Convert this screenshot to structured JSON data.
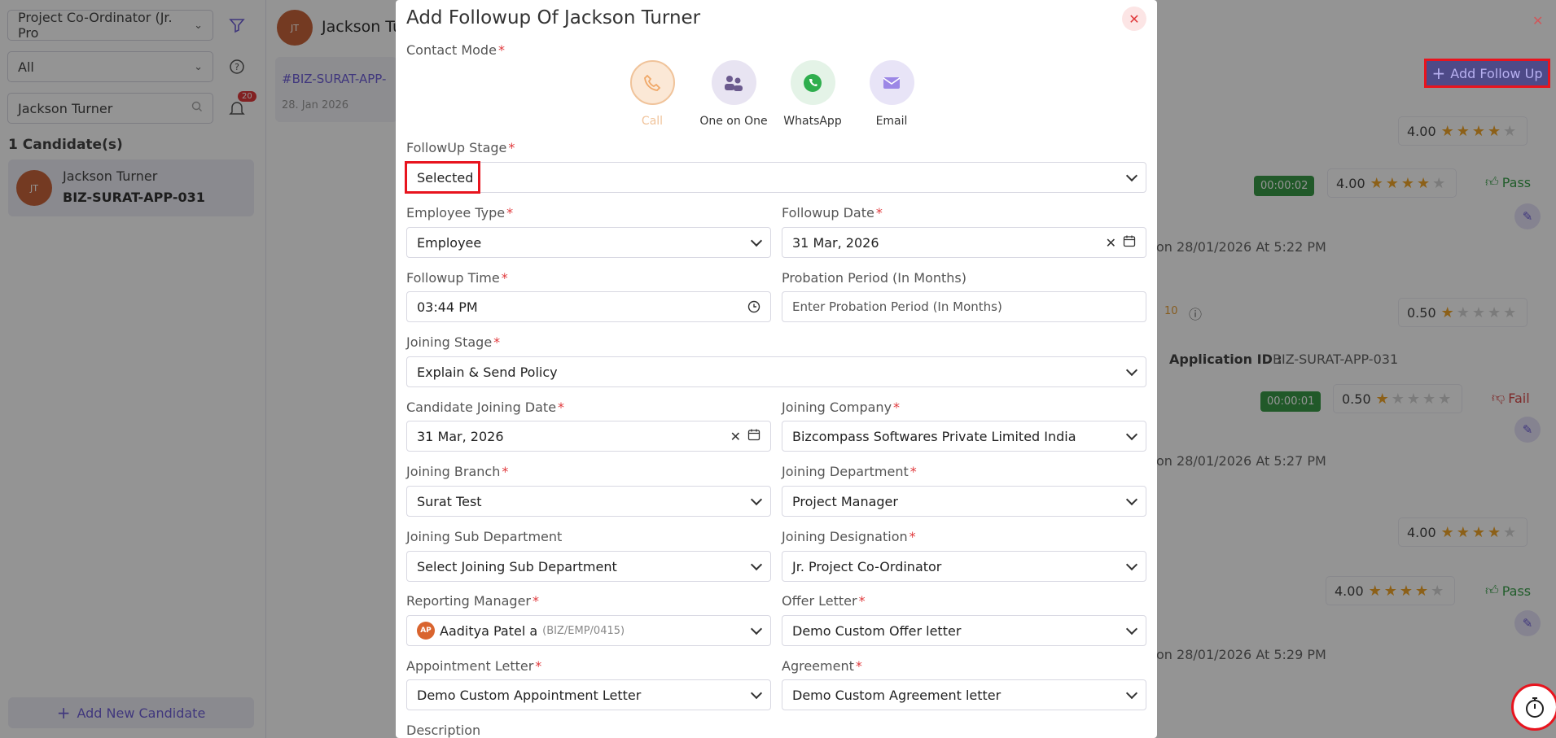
{
  "left_panel": {
    "role_filter": "Project Co-Ordinator (Jr. Pro",
    "status_filter": "All",
    "search_value": "Jackson Turner",
    "notification_count": "20",
    "candidate_count": "1 Candidate(s)",
    "candidate": {
      "initials": "JT",
      "name": "Jackson Turner",
      "app_id": "BIZ-SURAT-APP-031"
    },
    "add_candidate": "Add New Candidate"
  },
  "main": {
    "header_initials": "JT",
    "header_name": "Jackson Tu",
    "tab_id": "#BIZ-SURAT-APP-",
    "tab_date": "28. Jan 2026",
    "add_follow_up": "Add Follow Up",
    "ratings": [
      "4.00",
      "4.00",
      "0.50",
      "0.50",
      "4.00",
      "4.00"
    ],
    "timers": [
      "00:00:02",
      "00:00:01"
    ],
    "pass_label": "Pass",
    "fail_label": "Fail",
    "partial_number": "10",
    "logs": [
      "on 28/01/2026 At 5:22 PM",
      "on 28/01/2026 At 5:27 PM",
      "on 28/01/2026 At 5:29 PM"
    ],
    "application_id_label": "Application ID :",
    "application_id_value": "BIZ-SURAT-APP-031"
  },
  "modal": {
    "title": "Add Followup Of Jackson Turner",
    "contact_mode_label": "Contact Mode",
    "contact_modes": [
      {
        "label": "Call",
        "icon": "phone-icon",
        "active": true
      },
      {
        "label": "One on One",
        "icon": "meeting-icon",
        "active": false
      },
      {
        "label": "WhatsApp",
        "icon": "whatsapp-icon",
        "active": false
      },
      {
        "label": "Email",
        "icon": "envelope-icon",
        "active": false
      }
    ],
    "followup_stage": {
      "label": "FollowUp Stage",
      "value": "Selected"
    },
    "employee_type": {
      "label": "Employee Type",
      "value": "Employee"
    },
    "followup_date": {
      "label": "Followup Date",
      "value": "31 Mar, 2026"
    },
    "followup_time": {
      "label": "Followup Time",
      "value": "03:44 PM"
    },
    "probation": {
      "label": "Probation Period (In Months)",
      "placeholder": "Enter Probation Period (In Months)"
    },
    "joining_stage": {
      "label": "Joining Stage",
      "value": "Explain & Send Policy"
    },
    "candidate_joining_date": {
      "label": "Candidate Joining Date",
      "value": "31 Mar, 2026"
    },
    "joining_company": {
      "label": "Joining Company",
      "value": "Bizcompass Softwares Private Limited India"
    },
    "joining_branch": {
      "label": "Joining Branch",
      "value": "Surat Test"
    },
    "joining_department": {
      "label": "Joining Department",
      "value": "Project Manager"
    },
    "joining_sub_department": {
      "label": "Joining Sub Department",
      "value": "Select Joining Sub Department"
    },
    "joining_designation": {
      "label": "Joining Designation",
      "value": "Jr. Project Co-Ordinator"
    },
    "reporting_manager": {
      "label": "Reporting Manager",
      "initials": "AP",
      "value": "Aaditya Patel a",
      "code": "(BIZ/EMP/0415)"
    },
    "offer_letter": {
      "label": "Offer Letter",
      "value": "Demo Custom Offer letter"
    },
    "appointment_letter": {
      "label": "Appointment Letter",
      "value": "Demo Custom Appointment Letter"
    },
    "agreement": {
      "label": "Agreement",
      "value": "Demo Custom Agreement letter"
    },
    "description": {
      "label": "Description"
    }
  },
  "colors": {
    "accent": "#6f5fd8",
    "required": "#e0393c",
    "highlight": "#e8141e",
    "call_active": "#f0a868"
  }
}
